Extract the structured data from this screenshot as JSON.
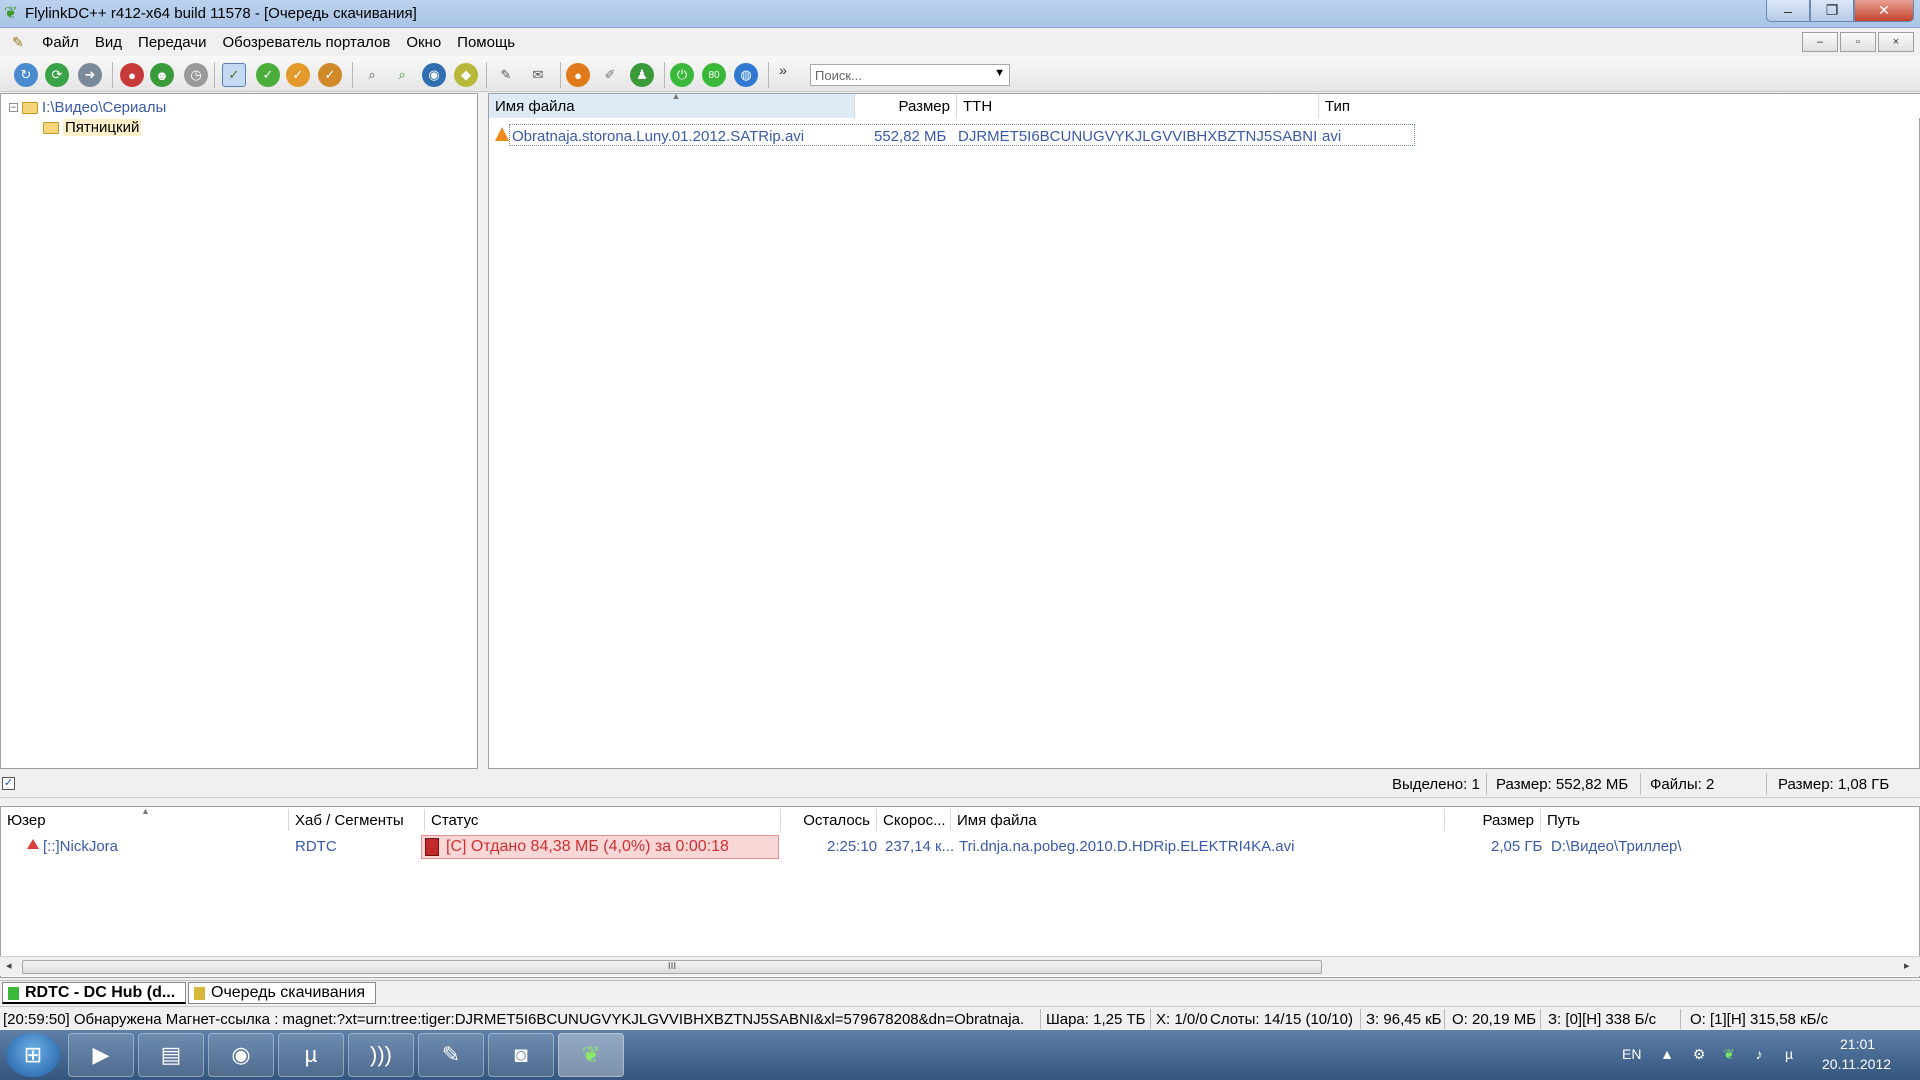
{
  "window": {
    "title": "FlylinkDC++ r412-x64 build 11578 - [Очередь скачивания]",
    "minimize": "–",
    "restore": "❐",
    "close": "✕"
  },
  "menu": {
    "items": [
      "Файл",
      "Вид",
      "Передачи",
      "Обозреватель порталов",
      "Окно",
      "Помощь"
    ],
    "mdi_minimize": "–",
    "mdi_restore": "▫",
    "mdi_close": "×"
  },
  "toolbar": {
    "overflow": "»",
    "search_placeholder": "Поиск...",
    "slots_badge": "80"
  },
  "tree": {
    "root": "I:\\Видео\\Сериалы",
    "child": "Пятницкий"
  },
  "file_list": {
    "columns": [
      "Имя файла",
      "Размер",
      "TTH",
      "Тип"
    ],
    "rows": [
      {
        "name": "Obratnaja.storona.Luny.01.2012.SATRip.avi",
        "size": "552,82 МБ",
        "tth": "DJRMET5I6BCUNUGVYKJLGVVIBHXBZTNJ5SABNI",
        "type": "avi"
      }
    ]
  },
  "info_strip": {
    "selected": "Выделено: 1",
    "size_selected": "Размер: 552,82 МБ",
    "files": "Файлы: 2",
    "size_total": "Размер: 1,08 ГБ"
  },
  "transfers": {
    "columns": [
      "Юзер",
      "Хаб / Сегменты",
      "Статус",
      "Осталось",
      "Скорос...",
      "Имя файла",
      "Размер",
      "Путь"
    ],
    "rows": [
      {
        "user": "[::]NickJora",
        "hub": "RDTC",
        "status": "[C] Отдано 84,38 МБ (4,0%) за 0:00:18",
        "remaining": "2:25:10",
        "speed": "237,14 к...",
        "filename": "Tri.dnja.na.pobeg.2010.D.HDRip.ELEKTRI4KA.avi",
        "size": "2,05 ГБ",
        "path": "D:\\Видео\\Триллер\\"
      }
    ],
    "scroll_grip": "III"
  },
  "tabs": [
    {
      "label": "RDTC - DC Hub (d...",
      "active": true
    },
    {
      "label": "Очередь скачивания",
      "active": false
    }
  ],
  "statusbar": {
    "log": "[20:59:50] Обнаружена Магнет-ссылка : magnet:?xt=urn:tree:tiger:DJRMET5I6BCUNUGVYKJLGVVIBHXBZTNJ5SABNI&xl=579678208&dn=Obratnaja.",
    "share": "Шара: 1,25 ТБ",
    "hubs": "Х: 1/0/0",
    "slots": "Слоты: 14/15 (10/10)",
    "download": "З: 96,45 кБ",
    "upload": "О: 20,19 МБ",
    "dl_speed": "З: [0][Н] 338 Б/с",
    "ul_speed": "О: [1][Н] 315,58 кБ/с"
  },
  "taskbar": {
    "lang": "EN",
    "time": "21:01",
    "date": "20.11.2012"
  }
}
